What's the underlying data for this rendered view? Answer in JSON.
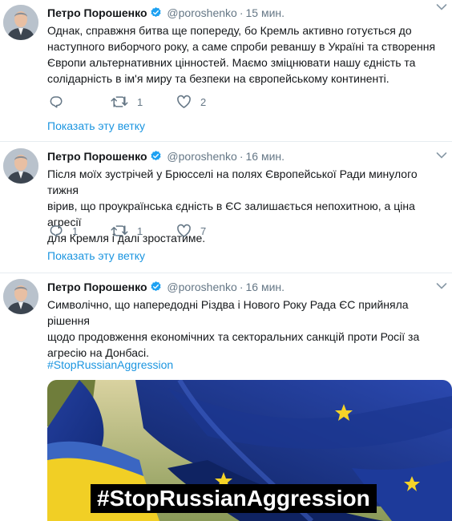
{
  "tweets": [
    {
      "name": "Петро Порошенко",
      "handle": "@poroshenko",
      "separator": "·",
      "time": "15 мин.",
      "lines": [
        "Однак, справжня битва ще попереду, бо Кремль активно готується до",
        "наступного виборчого року, а саме спроби реваншу в Україні та створення",
        "Європи альтернативних цінностей. Маємо зміцнювати нашу єдність та",
        "солідарність в ім'я миру та безпеки на європейському континенті."
      ],
      "reply_count": "",
      "retweet_count": "1",
      "like_count": "2",
      "thread_link": "Показать эту ветку"
    },
    {
      "name": "Петро Порошенко",
      "handle": "@poroshenko",
      "separator": "·",
      "time": "16 мин.",
      "lines": [
        "Після моїх зустрічей у Брюсселі на полях Європейської Ради минулого тижня",
        "вірив, що проукраїнська єдність в ЄС залишається непохитною, а ціна агресії",
        "для Кремля і далі зростатиме."
      ],
      "reply_count": "1",
      "retweet_count": "1",
      "like_count": "7",
      "thread_link": "Показать эту ветку"
    },
    {
      "name": "Петро Порошенко",
      "handle": "@poroshenko",
      "separator": "·",
      "time": "16 мин.",
      "lines": [
        "Символічно, що напередодні Різдва і Нового Року Рада ЄС прийняла рішення",
        "щодо продовження економічних та секторальних санкцій проти Росії за",
        "агресію на Донбасі."
      ],
      "hashtag": "#StopRussianAggression",
      "image_banner": "#StopRussianAggression"
    }
  ],
  "colors": {
    "link": "#1b95e0",
    "verified": "#1da1f2",
    "secondary": "#657786",
    "eu_blue": "#1f3fa0",
    "ukraine_yellow": "#f5d327"
  }
}
